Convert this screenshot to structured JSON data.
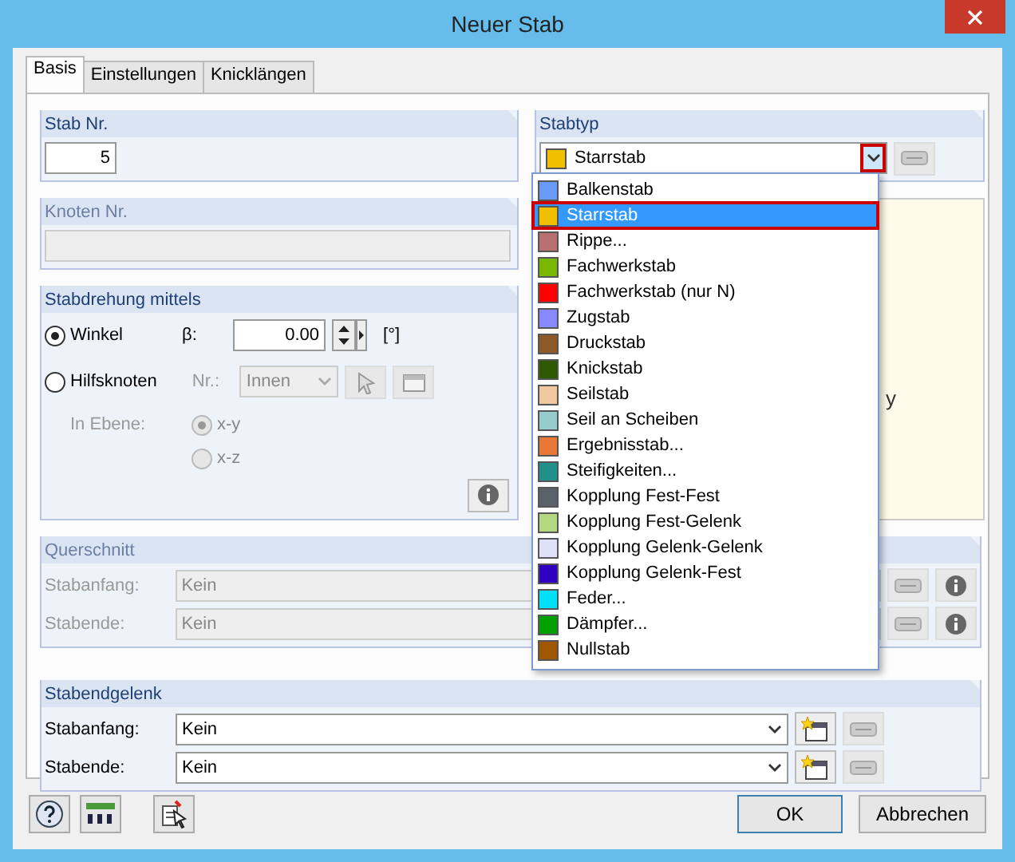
{
  "window": {
    "title": "Neuer Stab"
  },
  "tabs": [
    {
      "label": "Basis",
      "selected": true
    },
    {
      "label": "Einstellungen",
      "selected": false
    },
    {
      "label": "Knicklängen",
      "selected": false
    }
  ],
  "stab_nr": {
    "title": "Stab Nr.",
    "value": "5"
  },
  "knoten_nr": {
    "title": "Knoten Nr.",
    "disabled": true
  },
  "stabdrehung": {
    "title": "Stabdrehung mittels",
    "options": [
      {
        "label": "Winkel",
        "selected": true
      },
      {
        "label": "Hilfsknoten",
        "selected": false
      }
    ],
    "beta_label": "β:",
    "beta_value": "0.00",
    "unit": "[°]",
    "nr_label": "Nr.:",
    "nr_value": "Innen",
    "plane_label": "In Ebene:",
    "planes": [
      {
        "label": "x-y",
        "selected": true
      },
      {
        "label": "x-z",
        "selected": false
      }
    ]
  },
  "stabtyp": {
    "title": "Stabtyp",
    "value": "Starrstab",
    "color": "#f0c000",
    "expanded": true,
    "options": [
      {
        "label": "Balkenstab",
        "color": "#6a9af8",
        "selected": false
      },
      {
        "label": "Starrstab",
        "color": "#f0c000",
        "selected": true
      },
      {
        "label": "Rippe...",
        "color": "#b87070",
        "selected": false
      },
      {
        "label": "Fachwerkstab",
        "color": "#78b800",
        "selected": false
      },
      {
        "label": "Fachwerkstab (nur N)",
        "color": "#ff0000",
        "selected": false
      },
      {
        "label": "Zugstab",
        "color": "#8888ff",
        "selected": false
      },
      {
        "label": "Druckstab",
        "color": "#8c5a28",
        "selected": false
      },
      {
        "label": "Knickstab",
        "color": "#305800",
        "selected": false
      },
      {
        "label": "Seilstab",
        "color": "#f0c8a0",
        "selected": false
      },
      {
        "label": "Seil an Scheiben",
        "color": "#98cccc",
        "selected": false
      },
      {
        "label": "Ergebnisstab...",
        "color": "#e87838",
        "selected": false
      },
      {
        "label": "Steifigkeiten...",
        "color": "#209088",
        "selected": false
      },
      {
        "label": "Kopplung Fest-Fest",
        "color": "#5c6068",
        "selected": false
      },
      {
        "label": "Kopplung Fest-Gelenk",
        "color": "#b4d880",
        "selected": false
      },
      {
        "label": "Kopplung Gelenk-Gelenk",
        "color": "#e0e0f8",
        "selected": false
      },
      {
        "label": "Kopplung Gelenk-Fest",
        "color": "#3000c0",
        "selected": false
      },
      {
        "label": "Feder...",
        "color": "#00e0f8",
        "selected": false
      },
      {
        "label": "Dämpfer...",
        "color": "#00a000",
        "selected": false
      },
      {
        "label": "Nullstab",
        "color": "#a05800",
        "selected": false
      }
    ]
  },
  "preview": {
    "axis_label": "y"
  },
  "querschnitt": {
    "title": "Querschnitt",
    "disabled": true,
    "rows": [
      {
        "label": "Stabanfang:",
        "value": "Kein"
      },
      {
        "label": "Stabende:",
        "value": "Kein"
      }
    ]
  },
  "stabendgelenk": {
    "title": "Stabendgelenk",
    "disabled": false,
    "rows": [
      {
        "label": "Stabanfang:",
        "value": "Kein"
      },
      {
        "label": "Stabende:",
        "value": "Kein"
      }
    ]
  },
  "buttons": [
    {
      "label": "OK",
      "kind": "default"
    },
    {
      "label": "Abbrechen",
      "kind": "normal"
    }
  ]
}
